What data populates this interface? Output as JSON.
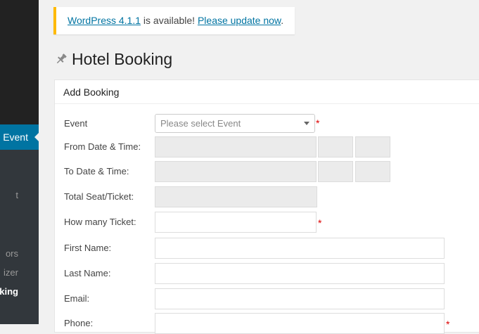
{
  "sidebar": {
    "active_item": "Event",
    "submenu": [
      {
        "label": "t",
        "current": false
      },
      {
        "label": "ors",
        "current": false
      },
      {
        "label": "izer",
        "current": false
      },
      {
        "label": "king",
        "current": true
      }
    ]
  },
  "notice": {
    "version_link": "WordPress 4.1.1",
    "middle_text": " is available! ",
    "update_link": "Please update now",
    "end_text": "."
  },
  "page": {
    "title": "Hotel Booking",
    "icon": "pin-icon"
  },
  "form": {
    "heading": "Add Booking",
    "required_mark": "*",
    "fields": {
      "event": {
        "label": "Event",
        "placeholder": "Please select Event"
      },
      "from_datetime": {
        "label": "From Date & Time:"
      },
      "to_datetime": {
        "label": "To Date & Time:"
      },
      "total_seat": {
        "label": "Total Seat/Ticket:"
      },
      "ticket_count": {
        "label": "How many Ticket:"
      },
      "first_name": {
        "label": "First Name:"
      },
      "last_name": {
        "label": "Last Name:"
      },
      "email": {
        "label": "Email:"
      },
      "phone": {
        "label": "Phone:"
      }
    }
  },
  "colors": {
    "accent": "#0074a2",
    "notice_border": "#ffba00",
    "required": "#dd0000",
    "sidebar_bg": "#222222"
  }
}
